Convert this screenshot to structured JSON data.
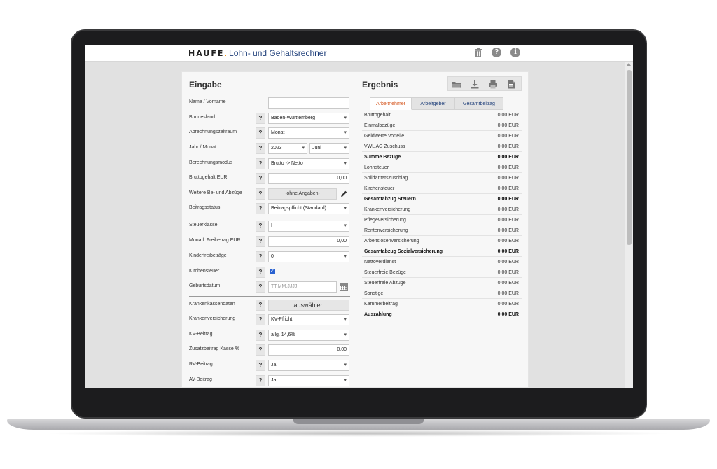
{
  "header": {
    "brand": "HAUFE",
    "dot": ".",
    "product": "Lohn- und Gehaltsrechner",
    "help_glyph": "?",
    "info_glyph": "i"
  },
  "icons": {
    "trash": "trash-icon",
    "help": "help-icon",
    "info": "info-icon",
    "folder": "folder-icon",
    "download": "download-icon",
    "print": "print-icon",
    "pdf": "pdf-icon",
    "pencil": "pencil-icon",
    "calendar": "calendar-icon"
  },
  "colors": {
    "active_tab": "#d4531b",
    "link_blue": "#1f3f7a",
    "checkbox": "#2a62d1",
    "brand_dot": "#f28c00"
  },
  "input": {
    "title": "Eingabe",
    "help_glyph": "?",
    "rows": {
      "name": {
        "label": "Name / Vorname",
        "value": ""
      },
      "bundesland": {
        "label": "Bundesland",
        "value": "Baden-Württemberg"
      },
      "abrechnungszeitraum": {
        "label": "Abrechnungszeitraum",
        "value": "Monat"
      },
      "jahr_monat": {
        "label": "Jahr / Monat",
        "year": "2023",
        "month": "Juni"
      },
      "berechnungsmodus": {
        "label": "Berechnungsmodus",
        "value": "Brutto -> Netto"
      },
      "bruttogehalt": {
        "label": "Bruttogehalt EUR",
        "value": "0,00"
      },
      "weitere": {
        "label": "Weitere Be- und Abzüge",
        "value": "-ohne Angaben-"
      },
      "beitragsstatus": {
        "label": "Beitragsstatus",
        "value": "Beitragspflicht (Standard)"
      },
      "steuerklasse": {
        "label": "Steuerklasse",
        "value": "I"
      },
      "freibetrag": {
        "label": "Monatl. Freibetrag EUR",
        "value": "0,00"
      },
      "kinderfreibetraege": {
        "label": "Kinderfreibeträge",
        "value": "0"
      },
      "kirchensteuer": {
        "label": "Kirchensteuer",
        "checked": true,
        "check_glyph": "✓"
      },
      "geburtsdatum": {
        "label": "Geburtsdatum",
        "placeholder": "TT.MM.JJJJ"
      },
      "krankenkassendaten": {
        "label": "Krankenkassendaten",
        "value": "auswählen"
      },
      "krankenversicherung": {
        "label": "Krankenversicherung",
        "value": "KV-Pflicht"
      },
      "kv_beitrag": {
        "label": "KV-Beitrag",
        "value": "allg. 14,6%"
      },
      "zusatzbeitrag": {
        "label": "Zusatzbeitrag Kasse %",
        "value": "0,00"
      },
      "rv_beitrag": {
        "label": "RV-Beitrag",
        "value": "Ja"
      },
      "av_beitrag": {
        "label": "AV-Beitrag",
        "value": "Ja"
      }
    }
  },
  "result": {
    "title": "Ergebnis",
    "tabs": [
      {
        "label": "Arbeitnehmer",
        "active": true
      },
      {
        "label": "Arbeitgeber",
        "active": false
      },
      {
        "label": "Gesamtbeitrag",
        "active": false
      }
    ],
    "rows": [
      {
        "label": "Bruttogehalt",
        "value": "0,00 EUR",
        "bold": false
      },
      {
        "label": "Einmalbezüge",
        "value": "0,00 EUR",
        "bold": false
      },
      {
        "label": "Geldwerte Vorteile",
        "value": "0,00 EUR",
        "bold": false
      },
      {
        "label": "VWL AG Zuschuss",
        "value": "0,00 EUR",
        "bold": false
      },
      {
        "label": "Summe Bezüge",
        "value": "0,00 EUR",
        "bold": true
      },
      {
        "label": "Lohnsteuer",
        "value": "0,00 EUR",
        "bold": false
      },
      {
        "label": "Solidaritätszuschlag",
        "value": "0,00 EUR",
        "bold": false
      },
      {
        "label": "Kirchensteuer",
        "value": "0,00 EUR",
        "bold": false
      },
      {
        "label": "Gesamtabzug Steuern",
        "value": "0,00 EUR",
        "bold": true
      },
      {
        "label": "Krankenversicherung",
        "value": "0,00 EUR",
        "bold": false
      },
      {
        "label": "Pflegeversicherung",
        "value": "0,00 EUR",
        "bold": false
      },
      {
        "label": "Rentenversicherung",
        "value": "0,00 EUR",
        "bold": false
      },
      {
        "label": "Arbeitslosenversicherung",
        "value": "0,00 EUR",
        "bold": false
      },
      {
        "label": "Gesamtabzug Sozialversicherung",
        "value": "0,00 EUR",
        "bold": true
      },
      {
        "label": "Nettoverdienst",
        "value": "0,00 EUR",
        "bold": false
      },
      {
        "label": "Steuerfreie Bezüge",
        "value": "0,00 EUR",
        "bold": false
      },
      {
        "label": "Steuerfreie Abzüge",
        "value": "0,00 EUR",
        "bold": false
      },
      {
        "label": "Sonstige",
        "value": "0,00 EUR",
        "bold": false
      },
      {
        "label": "Kammerbeitrag",
        "value": "0,00 EUR",
        "bold": false
      },
      {
        "label": "Auszahlung",
        "value": "0,00 EUR",
        "bold": true
      }
    ]
  }
}
